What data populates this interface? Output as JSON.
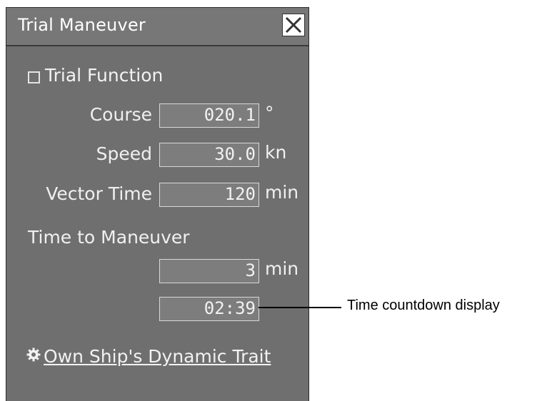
{
  "window": {
    "title": "Trial Maneuver",
    "close_icon": "close-icon"
  },
  "trial_function": {
    "label": "Trial Function",
    "checked": false
  },
  "course": {
    "label": "Course",
    "value": "020.1",
    "unit": "°"
  },
  "speed": {
    "label": "Speed",
    "value": "30.0",
    "unit": "kn"
  },
  "vector_time": {
    "label": "Vector Time",
    "value": "120",
    "unit": "min"
  },
  "time_to_maneuver": {
    "label": "Time to Maneuver",
    "value": "3",
    "unit": "min",
    "countdown": "02:39"
  },
  "link": {
    "icon": "gear-icon",
    "label": "Own Ship's Dynamic Trait"
  },
  "annotation": {
    "label": "Time countdown display"
  },
  "colors": {
    "panel": "#6f6f6f",
    "titlebar": "#777777",
    "field": "#7d7d7d",
    "text": "#f2f2f2"
  }
}
